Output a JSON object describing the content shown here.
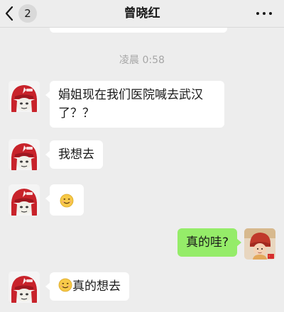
{
  "nav": {
    "back_icon": "chevron-left-icon",
    "unread_count": "2",
    "title": "曾晓红",
    "more_icon": "more-dots-icon"
  },
  "chat": {
    "timestamp": "凌晨 0:58",
    "messages": [
      {
        "side": "left",
        "text": "娟姐现在我们医院喊去武汉了？？"
      },
      {
        "side": "left",
        "text": "我想去"
      },
      {
        "side": "left",
        "text": "",
        "emoji": "awkward-smile-emoji"
      },
      {
        "side": "right",
        "text": "真的哇?"
      },
      {
        "side": "left",
        "text": "真的想去",
        "emoji": "awkward-smile-emoji"
      }
    ]
  },
  "colors": {
    "background": "#EDEDED",
    "bubble_incoming": "#FFFFFF",
    "bubble_outgoing": "#95EC69",
    "timestamp": "#A6A6A6"
  }
}
